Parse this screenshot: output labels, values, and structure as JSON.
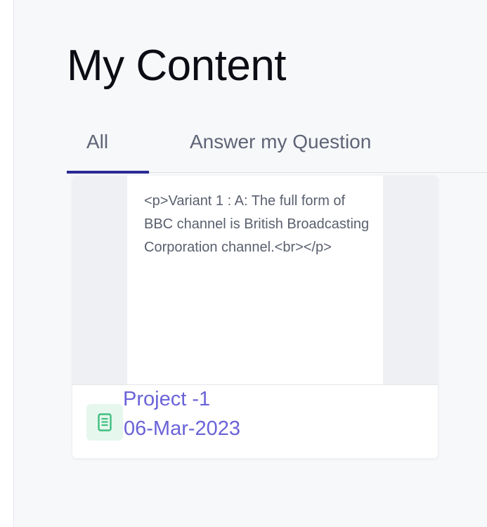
{
  "page": {
    "title": "My Content"
  },
  "tabs": [
    {
      "label": "All",
      "active": true
    },
    {
      "label": "Answer my Question",
      "active": false
    }
  ],
  "content_card": {
    "preview_text": "<p>Variant 1 : A: The full form of BBC channel is British Broadcasting Corporation channel.<br></p>",
    "project_name": "Project -1",
    "date": "06-Mar-2023",
    "icon": "document-icon"
  },
  "colors": {
    "accent": "#2b2a94",
    "link": "#6a63d8",
    "icon_green": "#3fbf7f",
    "icon_bg": "#e6f7ee"
  }
}
